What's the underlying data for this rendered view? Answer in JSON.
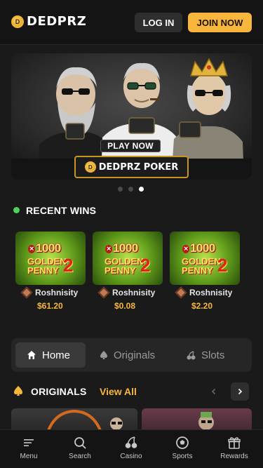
{
  "header": {
    "logo_text": "DEDPRZ",
    "logo_badge": "D",
    "login_label": "LOG IN",
    "join_label": "JOIN NOW"
  },
  "banner": {
    "play_label": "PLAY NOW",
    "brand_text": "DEDPRZ POKER",
    "slide_count": 3,
    "active_slide": 3
  },
  "recent_wins": {
    "title": "RECENT WINS",
    "items": [
      {
        "game_multiplier": "1000",
        "game_line": "GOLDEN PENNY",
        "game_num": "2",
        "user": "Roshnisity",
        "amount": "$61.20"
      },
      {
        "game_multiplier": "1000",
        "game_line": "GOLDEN PENNY",
        "game_num": "2",
        "user": "Roshnisity",
        "amount": "$0.08"
      },
      {
        "game_multiplier": "1000",
        "game_line": "GOLDEN PENNY",
        "game_num": "2",
        "user": "Roshnisity",
        "amount": "$2.20"
      }
    ]
  },
  "tabs": [
    {
      "label": "Home",
      "icon": "home-icon",
      "active": true
    },
    {
      "label": "Originals",
      "icon": "spade-icon",
      "active": false
    },
    {
      "label": "Slots",
      "icon": "cherry-icon",
      "active": false
    }
  ],
  "originals": {
    "title": "ORIGINALS",
    "view_all": "View All"
  },
  "bottom_nav": [
    {
      "label": "Menu",
      "icon": "menu-icon"
    },
    {
      "label": "Search",
      "icon": "search-icon"
    },
    {
      "label": "Casino",
      "icon": "cherry-icon"
    },
    {
      "label": "Sports",
      "icon": "soccer-ball-icon"
    },
    {
      "label": "Rewards",
      "icon": "gift-icon"
    }
  ],
  "colors": {
    "accent": "#f8b73c",
    "background": "#1a1a1a",
    "online": "#4fd15a"
  }
}
